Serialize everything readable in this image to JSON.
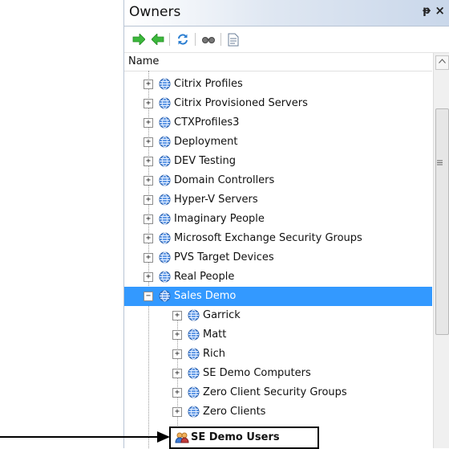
{
  "panel": {
    "title": "Owners",
    "pin_glyph": "ᵽ",
    "close_glyph": "×"
  },
  "toolbar": {
    "icons": [
      "forward-arrow-icon",
      "back-arrow-icon",
      "refresh-icon",
      "view-icon",
      "properties-icon"
    ]
  },
  "header": {
    "name_label": "Name"
  },
  "colors": {
    "selection": "#3399ff",
    "folder_globe": "#3d7ad6",
    "arrow_green": "#3cb83c"
  },
  "tree": {
    "items": [
      {
        "label": "Citrix Profiles",
        "level": 1,
        "expand": "+"
      },
      {
        "label": "Citrix Provisioned Servers",
        "level": 1,
        "expand": "+"
      },
      {
        "label": "CTXProfiles3",
        "level": 1,
        "expand": "+"
      },
      {
        "label": "Deployment",
        "level": 1,
        "expand": "+"
      },
      {
        "label": "DEV Testing",
        "level": 1,
        "expand": "+"
      },
      {
        "label": "Domain Controllers",
        "level": 1,
        "expand": "+"
      },
      {
        "label": "Hyper-V Servers",
        "level": 1,
        "expand": "+"
      },
      {
        "label": "Imaginary People",
        "level": 1,
        "expand": "+"
      },
      {
        "label": "Microsoft Exchange Security Groups",
        "level": 1,
        "expand": "+"
      },
      {
        "label": "PVS Target Devices",
        "level": 1,
        "expand": "+"
      },
      {
        "label": "Real People",
        "level": 1,
        "expand": "+"
      },
      {
        "label": "Sales Demo",
        "level": 1,
        "expand": "−",
        "selected": true
      },
      {
        "label": "Garrick",
        "level": 2,
        "expand": "+"
      },
      {
        "label": "Matt",
        "level": 2,
        "expand": "+"
      },
      {
        "label": "Rich",
        "level": 2,
        "expand": "+"
      },
      {
        "label": "SE Demo Computers",
        "level": 2,
        "expand": "+"
      },
      {
        "label": "Zero Client Security Groups",
        "level": 2,
        "expand": "+"
      },
      {
        "label": "Zero Clients",
        "level": 2,
        "expand": "+"
      }
    ]
  },
  "callout": {
    "label": "SE Demo Users"
  }
}
